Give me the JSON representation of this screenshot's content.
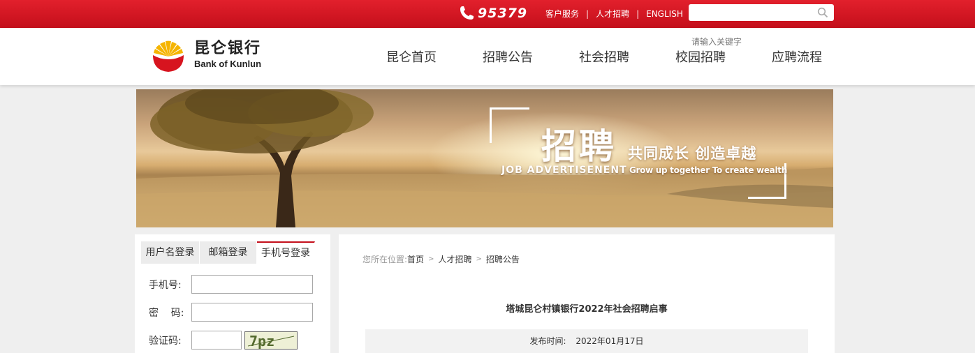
{
  "topbar": {
    "hotline": "95379",
    "links": [
      "客户服务",
      "人才招聘",
      "ENGLISH"
    ],
    "search_placeholder": "",
    "colors": {
      "bar_red": "#d41826"
    }
  },
  "header": {
    "logo_cn": "昆仑银行",
    "logo_en": "Bank of Kunlun",
    "keyword_hint": "请输入关键字",
    "nav": [
      "昆仑首页",
      "招聘公告",
      "社会招聘",
      "校园招聘",
      "应聘流程"
    ]
  },
  "banner": {
    "title": "招聘",
    "slogan": "共同成长  创造卓越",
    "subtitle_en_left": "JOB   ADVERTISENENT",
    "subtitle_en_right": "Grow up together To create wealth"
  },
  "login": {
    "tabs": [
      "用户名登录",
      "邮箱登录",
      "手机号登录"
    ],
    "active_tab": "手机号登录",
    "phone_label": "手机号:",
    "password_label": "密    码:",
    "captcha_label": "验证码:",
    "captcha_text": "7pz"
  },
  "article": {
    "breadcrumb_prefix": "您所在位置:",
    "breadcrumb": [
      "首页",
      "人才招聘",
      "招聘公告"
    ],
    "title": "塔城昆仑村镇银行2022年社会招聘启事",
    "publish_label": "发布时间:",
    "publish_date": "2022年01月17日"
  }
}
